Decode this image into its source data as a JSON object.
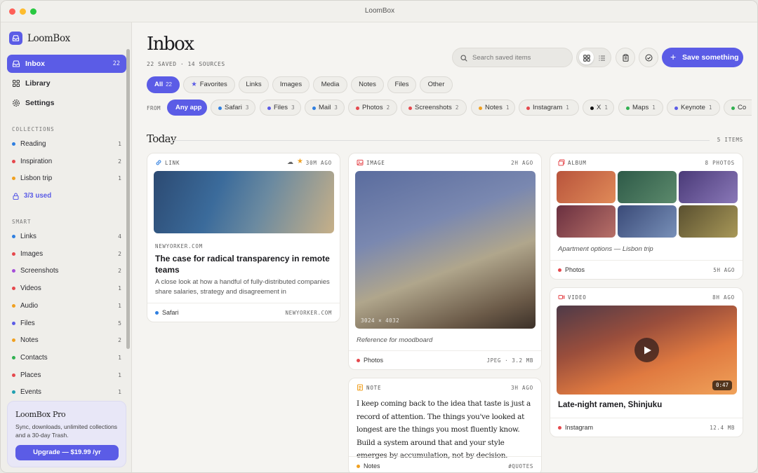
{
  "window": {
    "title": "LoomBox"
  },
  "sidebar": {
    "brand": "LoomBox",
    "nav": [
      {
        "label": "Inbox",
        "count": "22"
      },
      {
        "label": "Library"
      },
      {
        "label": "Settings"
      }
    ],
    "collections_title": "COLLECTIONS",
    "collections": [
      {
        "label": "Reading",
        "count": "1",
        "color": "#2f7fe0"
      },
      {
        "label": "Inspiration",
        "count": "2",
        "color": "#e5484d"
      },
      {
        "label": "Lisbon trip",
        "count": "1",
        "color": "#f0a020"
      }
    ],
    "used": "3/3 used",
    "smart_title": "SMART",
    "smart": [
      {
        "label": "Links",
        "count": "4",
        "color": "#2f7fe0"
      },
      {
        "label": "Images",
        "count": "2",
        "color": "#e5484d"
      },
      {
        "label": "Screenshots",
        "count": "2",
        "color": "#a54fd8"
      },
      {
        "label": "Videos",
        "count": "1",
        "color": "#e5484d"
      },
      {
        "label": "Audio",
        "count": "1",
        "color": "#f0a020"
      },
      {
        "label": "Files",
        "count": "5",
        "color": "#5b5ce6"
      },
      {
        "label": "Notes",
        "count": "2",
        "color": "#f0a020"
      },
      {
        "label": "Contacts",
        "count": "1",
        "color": "#30b050"
      },
      {
        "label": "Places",
        "count": "1",
        "color": "#e5484d"
      },
      {
        "label": "Events",
        "count": "1",
        "color": "#20a0b0"
      }
    ],
    "pro": {
      "title": "LoomBox Pro",
      "desc": "Sync, downloads, unlimited collections and a 30-day Trash.",
      "button": "Upgrade —  $19.99 /yr"
    }
  },
  "header": {
    "title": "Inbox",
    "subtitle": "22 SAVED · 14 SOURCES",
    "search_placeholder": "Search saved items",
    "save_label": "Save something"
  },
  "filters": [
    {
      "label": "All",
      "count": "22"
    },
    {
      "label": "Favorites"
    },
    {
      "label": "Links"
    },
    {
      "label": "Images"
    },
    {
      "label": "Media"
    },
    {
      "label": "Notes"
    },
    {
      "label": "Files"
    },
    {
      "label": "Other"
    }
  ],
  "from_label": "FROM",
  "apps": [
    {
      "label": "Any app"
    },
    {
      "label": "Safari",
      "count": "3",
      "color": "#2f7fe0"
    },
    {
      "label": "Files",
      "count": "3",
      "color": "#5b5ce6"
    },
    {
      "label": "Mail",
      "count": "3",
      "color": "#2f7fe0"
    },
    {
      "label": "Photos",
      "count": "2",
      "color": "#e5484d"
    },
    {
      "label": "Screenshots",
      "count": "2",
      "color": "#e5484d"
    },
    {
      "label": "Notes",
      "count": "1",
      "color": "#f0a020"
    },
    {
      "label": "Instagram",
      "count": "1",
      "color": "#e5484d"
    },
    {
      "label": "X",
      "count": "1",
      "color": "#111111"
    },
    {
      "label": "Maps",
      "count": "1",
      "color": "#30b050"
    },
    {
      "label": "Keynote",
      "count": "1",
      "color": "#5b5ce6"
    },
    {
      "label": "Co",
      "count": "",
      "color": "#30b050"
    }
  ],
  "section": {
    "title": "Today",
    "count": "5 ITEMS"
  },
  "cards": {
    "link": {
      "kind": "LINK",
      "age": "30M AGO",
      "domain": "NEWYORKER.COM",
      "title": "The case for radical transparency in remote teams",
      "desc": "A close look at how a handful of fully-distributed companies share salaries, strategy and disagreement in",
      "source": "Safari",
      "source_color": "#2f7fe0",
      "right": "NEWYORKER.COM"
    },
    "image": {
      "kind": "IMAGE",
      "age": "2H AGO",
      "dims": "3024 × 4032",
      "caption": "Reference for moodboard",
      "source": "Photos",
      "source_color": "#e5484d",
      "right": "JPEG · 3.2 MB"
    },
    "note": {
      "kind": "NOTE",
      "age": "3H AGO",
      "text": "I keep coming back to the idea that taste is just a record of attention. The things you've looked at longest are the things you most fluently know. Build a system around that and your style emerges by accumulation, not by decision.",
      "source": "Notes",
      "source_color": "#f0a020",
      "right": "#QUOTES"
    },
    "album": {
      "kind": "ALBUM",
      "age": "8 PHOTOS",
      "caption": "Apartment options — Lisbon trip",
      "source": "Photos",
      "source_color": "#e5484d",
      "right": "5H AGO"
    },
    "video": {
      "kind": "VIDEO",
      "age": "8H AGO",
      "duration": "0:47",
      "title": "Late-night ramen, Shinjuku",
      "source": "Instagram",
      "source_color": "#e5484d",
      "right": "12.4 MB"
    }
  }
}
